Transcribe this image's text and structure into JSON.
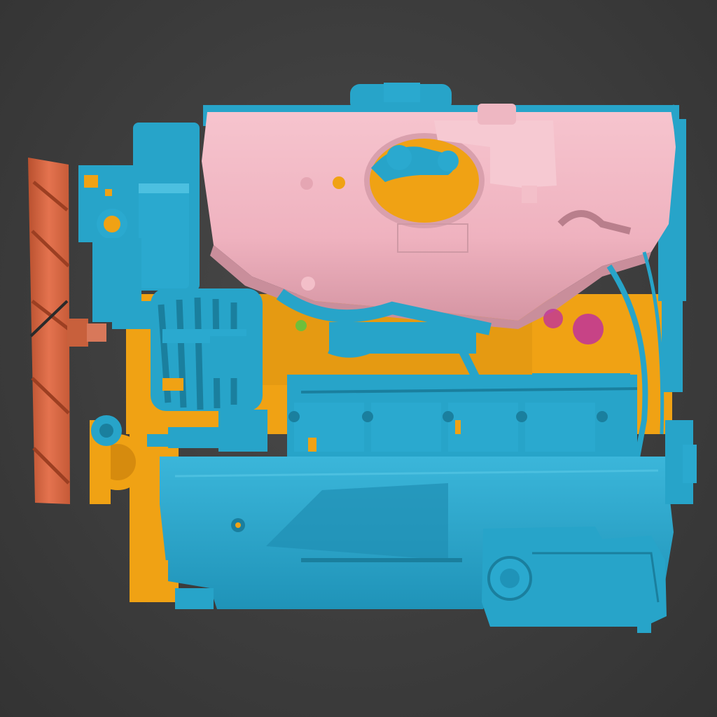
{
  "scene": {
    "subject": "engine-3d-scan",
    "colors": {
      "background": "#3c3c3c",
      "block": "#27a4c9",
      "block_shade": "#1a7f9e",
      "block_light": "#4cc0e0",
      "deviation_yellow": "#f0a214",
      "deviation_yellow_dark": "#c07c08",
      "cover_pink": "#f0b4c0",
      "cover_pink_shade": "#c98e9b",
      "fan_orange": "#df6a48",
      "fan_orange_dark": "#a8452a",
      "accent_magenta": "#c0339a",
      "accent_green": "#6fbf3a"
    }
  }
}
